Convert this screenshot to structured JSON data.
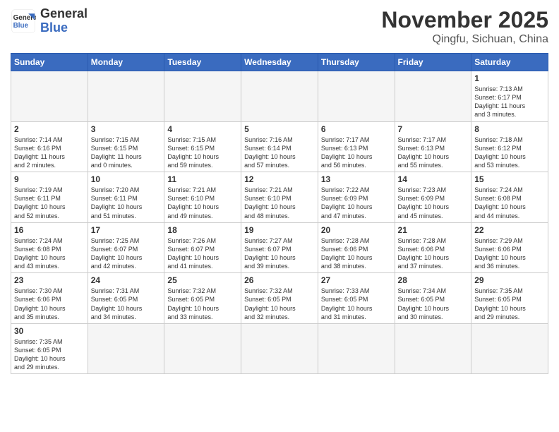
{
  "header": {
    "logo_line1": "General",
    "logo_line2": "Blue",
    "month_year": "November 2025",
    "location": "Qingfu, Sichuan, China"
  },
  "weekdays": [
    "Sunday",
    "Monday",
    "Tuesday",
    "Wednesday",
    "Thursday",
    "Friday",
    "Saturday"
  ],
  "weeks": [
    [
      {
        "day": "",
        "info": ""
      },
      {
        "day": "",
        "info": ""
      },
      {
        "day": "",
        "info": ""
      },
      {
        "day": "",
        "info": ""
      },
      {
        "day": "",
        "info": ""
      },
      {
        "day": "",
        "info": ""
      },
      {
        "day": "1",
        "info": "Sunrise: 7:13 AM\nSunset: 6:17 PM\nDaylight: 11 hours\nand 3 minutes."
      }
    ],
    [
      {
        "day": "2",
        "info": "Sunrise: 7:14 AM\nSunset: 6:16 PM\nDaylight: 11 hours\nand 2 minutes."
      },
      {
        "day": "3",
        "info": "Sunrise: 7:15 AM\nSunset: 6:15 PM\nDaylight: 11 hours\nand 0 minutes."
      },
      {
        "day": "4",
        "info": "Sunrise: 7:15 AM\nSunset: 6:15 PM\nDaylight: 10 hours\nand 59 minutes."
      },
      {
        "day": "5",
        "info": "Sunrise: 7:16 AM\nSunset: 6:14 PM\nDaylight: 10 hours\nand 57 minutes."
      },
      {
        "day": "6",
        "info": "Sunrise: 7:17 AM\nSunset: 6:13 PM\nDaylight: 10 hours\nand 56 minutes."
      },
      {
        "day": "7",
        "info": "Sunrise: 7:17 AM\nSunset: 6:13 PM\nDaylight: 10 hours\nand 55 minutes."
      },
      {
        "day": "8",
        "info": "Sunrise: 7:18 AM\nSunset: 6:12 PM\nDaylight: 10 hours\nand 53 minutes."
      }
    ],
    [
      {
        "day": "9",
        "info": "Sunrise: 7:19 AM\nSunset: 6:11 PM\nDaylight: 10 hours\nand 52 minutes."
      },
      {
        "day": "10",
        "info": "Sunrise: 7:20 AM\nSunset: 6:11 PM\nDaylight: 10 hours\nand 51 minutes."
      },
      {
        "day": "11",
        "info": "Sunrise: 7:21 AM\nSunset: 6:10 PM\nDaylight: 10 hours\nand 49 minutes."
      },
      {
        "day": "12",
        "info": "Sunrise: 7:21 AM\nSunset: 6:10 PM\nDaylight: 10 hours\nand 48 minutes."
      },
      {
        "day": "13",
        "info": "Sunrise: 7:22 AM\nSunset: 6:09 PM\nDaylight: 10 hours\nand 47 minutes."
      },
      {
        "day": "14",
        "info": "Sunrise: 7:23 AM\nSunset: 6:09 PM\nDaylight: 10 hours\nand 45 minutes."
      },
      {
        "day": "15",
        "info": "Sunrise: 7:24 AM\nSunset: 6:08 PM\nDaylight: 10 hours\nand 44 minutes."
      }
    ],
    [
      {
        "day": "16",
        "info": "Sunrise: 7:24 AM\nSunset: 6:08 PM\nDaylight: 10 hours\nand 43 minutes."
      },
      {
        "day": "17",
        "info": "Sunrise: 7:25 AM\nSunset: 6:07 PM\nDaylight: 10 hours\nand 42 minutes."
      },
      {
        "day": "18",
        "info": "Sunrise: 7:26 AM\nSunset: 6:07 PM\nDaylight: 10 hours\nand 41 minutes."
      },
      {
        "day": "19",
        "info": "Sunrise: 7:27 AM\nSunset: 6:07 PM\nDaylight: 10 hours\nand 39 minutes."
      },
      {
        "day": "20",
        "info": "Sunrise: 7:28 AM\nSunset: 6:06 PM\nDaylight: 10 hours\nand 38 minutes."
      },
      {
        "day": "21",
        "info": "Sunrise: 7:28 AM\nSunset: 6:06 PM\nDaylight: 10 hours\nand 37 minutes."
      },
      {
        "day": "22",
        "info": "Sunrise: 7:29 AM\nSunset: 6:06 PM\nDaylight: 10 hours\nand 36 minutes."
      }
    ],
    [
      {
        "day": "23",
        "info": "Sunrise: 7:30 AM\nSunset: 6:06 PM\nDaylight: 10 hours\nand 35 minutes."
      },
      {
        "day": "24",
        "info": "Sunrise: 7:31 AM\nSunset: 6:05 PM\nDaylight: 10 hours\nand 34 minutes."
      },
      {
        "day": "25",
        "info": "Sunrise: 7:32 AM\nSunset: 6:05 PM\nDaylight: 10 hours\nand 33 minutes."
      },
      {
        "day": "26",
        "info": "Sunrise: 7:32 AM\nSunset: 6:05 PM\nDaylight: 10 hours\nand 32 minutes."
      },
      {
        "day": "27",
        "info": "Sunrise: 7:33 AM\nSunset: 6:05 PM\nDaylight: 10 hours\nand 31 minutes."
      },
      {
        "day": "28",
        "info": "Sunrise: 7:34 AM\nSunset: 6:05 PM\nDaylight: 10 hours\nand 30 minutes."
      },
      {
        "day": "29",
        "info": "Sunrise: 7:35 AM\nSunset: 6:05 PM\nDaylight: 10 hours\nand 29 minutes."
      }
    ],
    [
      {
        "day": "30",
        "info": "Sunrise: 7:35 AM\nSunset: 6:05 PM\nDaylight: 10 hours\nand 29 minutes."
      },
      {
        "day": "",
        "info": ""
      },
      {
        "day": "",
        "info": ""
      },
      {
        "day": "",
        "info": ""
      },
      {
        "day": "",
        "info": ""
      },
      {
        "day": "",
        "info": ""
      },
      {
        "day": "",
        "info": ""
      }
    ]
  ]
}
